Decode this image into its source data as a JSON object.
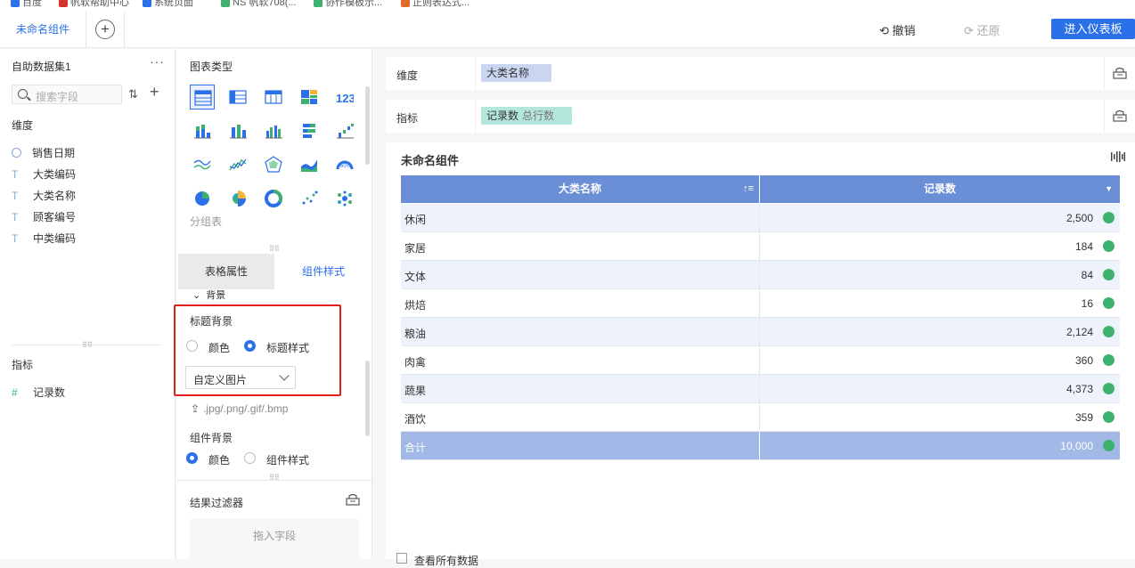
{
  "bookmarks": [
    {
      "label": "百度",
      "color": "#2b70e9"
    },
    {
      "label": "帆软帮助中心",
      "color": "#d6322c"
    },
    {
      "label": "系统页面",
      "color": "#2b70e9"
    },
    {
      "label": "NS 帆软708(...",
      "color": "#3db26f"
    },
    {
      "label": "协作模板示...",
      "color": "#3db26f"
    },
    {
      "label": "正则表达式...",
      "color": "#e06a2a"
    }
  ],
  "topbar": {
    "tab_active": "未命名组件",
    "undo_label": "撤销",
    "redo_label": "还原",
    "enter_label": "进入仪表板"
  },
  "left": {
    "dataset_title": "自助数据集1",
    "more": "···",
    "search_placeholder": "搜索字段",
    "dim_label": "维度",
    "dimensions": [
      {
        "label": "销售日期",
        "icon": "clock-icon"
      },
      {
        "label": "大类编码",
        "icon": "text-type-icon"
      },
      {
        "label": "大类名称",
        "icon": "text-type-icon"
      },
      {
        "label": "顾客编号",
        "icon": "text-type-icon"
      },
      {
        "label": "中类编码",
        "icon": "text-type-icon"
      }
    ],
    "metric_label": "指标",
    "metrics": [
      {
        "label": "记录数",
        "icon": "number-type-icon"
      }
    ]
  },
  "mid": {
    "chart_type_title": "图表类型",
    "group_label": "分组表",
    "tab_table_attr": "表格属性",
    "tab_component_style": "组件样式",
    "bg_section": "背景",
    "title_bg_label": "标题背景",
    "radio_color": "颜色",
    "radio_title_style": "标题样式",
    "title_bg_selected": "title_style",
    "select_value": "自定义图片",
    "upload_hint": ".jpg/.png/.gif/.bmp",
    "component_bg_label": "组件背景",
    "radio_color2": "颜色",
    "radio_component_style": "组件样式",
    "component_bg_selected": "color",
    "filter_title": "结果过滤器",
    "drop_hint": "拖入字段"
  },
  "shelf": {
    "dim_label": "维度",
    "dim_pill": "大类名称",
    "metric_label": "指标",
    "metric_pill": "记录数",
    "metric_pill_sub": "总行数"
  },
  "card": {
    "title": "未命名组件",
    "col1": "大类名称",
    "col2": "记录数",
    "rows": [
      {
        "name": "休闲",
        "value": "2,500"
      },
      {
        "name": "家居",
        "value": "184"
      },
      {
        "name": "文体",
        "value": "84"
      },
      {
        "name": "烘焙",
        "value": "16"
      },
      {
        "name": "粮油",
        "value": "2,124"
      },
      {
        "name": "肉禽",
        "value": "360"
      },
      {
        "name": "蔬果",
        "value": "4,373"
      },
      {
        "name": "酒饮",
        "value": "359"
      }
    ],
    "total_label": "合计",
    "total_value": "10,000",
    "dot_color": "#3db26f",
    "header_color": "#6b8fd6",
    "bottom_text": "查看所有数据"
  }
}
